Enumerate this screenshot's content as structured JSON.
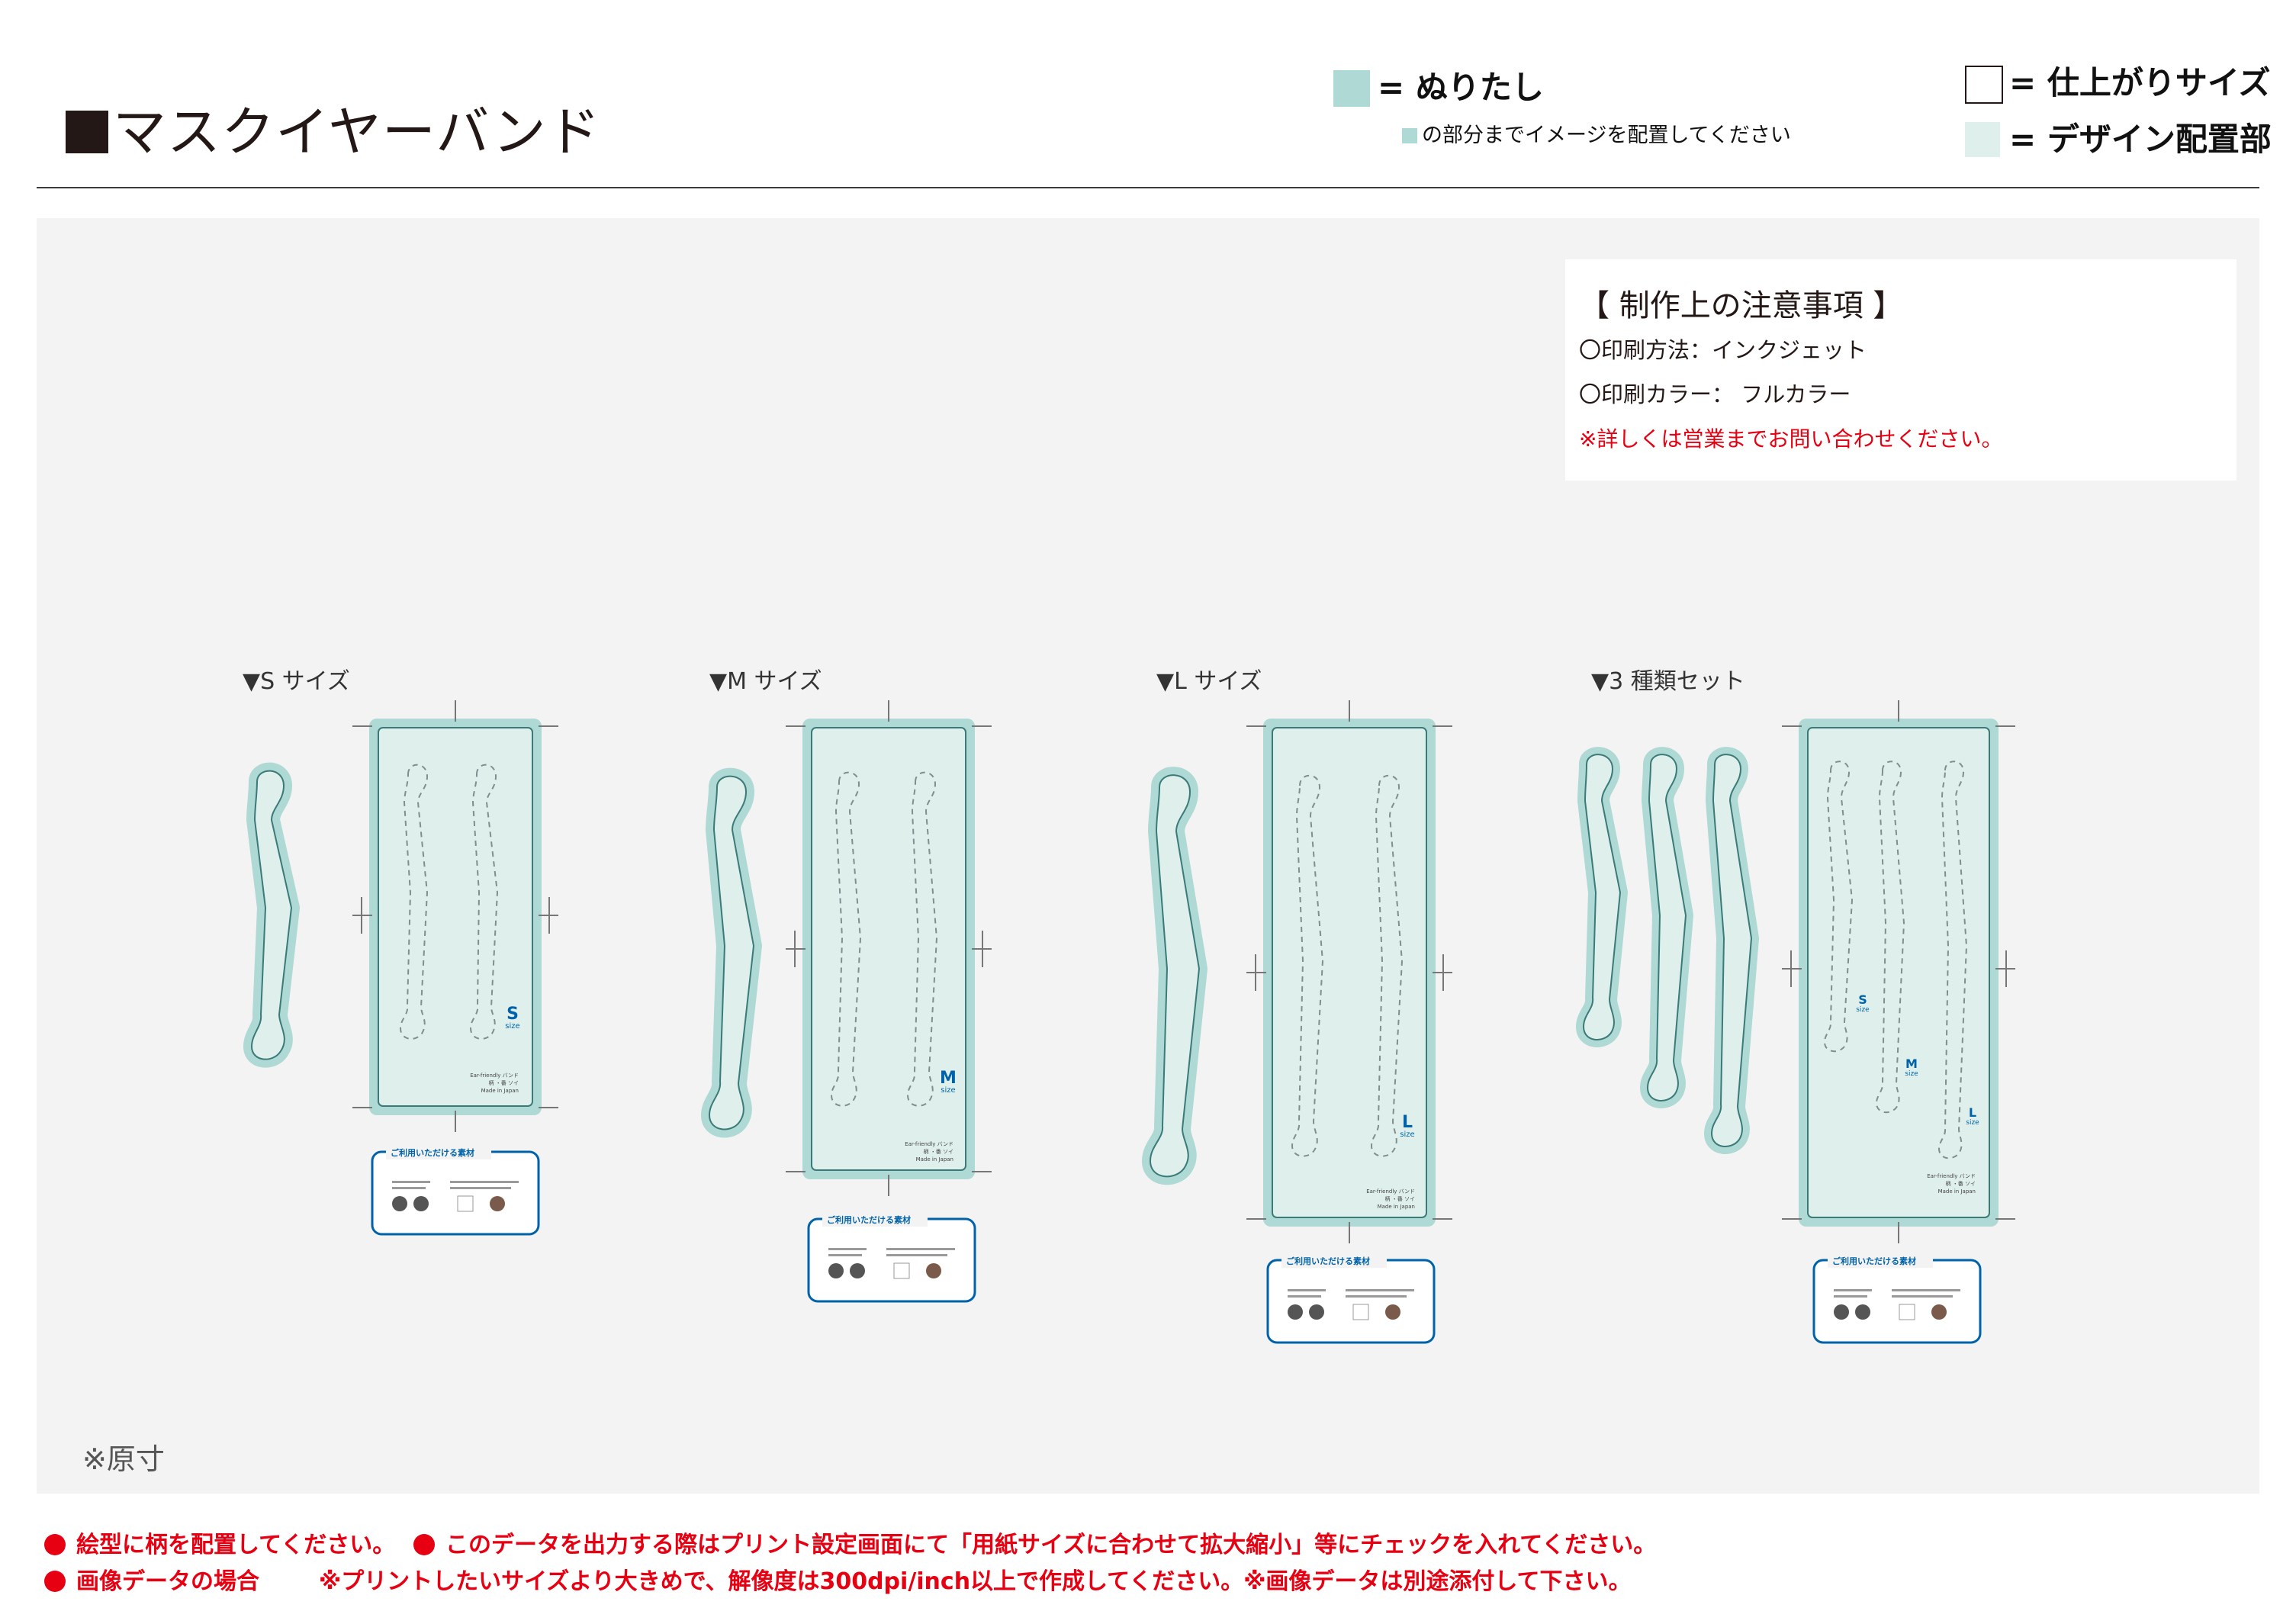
{
  "header": {
    "title": "マスクイヤーバンド",
    "legend_bleed_label": "= ぬりたし",
    "legend_bleed_note": "の部分までイメージを配置してください",
    "legend_finish_label": "= 仕上がりサイズ",
    "legend_design_label": "= デザイン配置部"
  },
  "notes": {
    "title": "【 制作上の注意事項 】",
    "print_method": "〇印刷方法：インクジェット",
    "print_color": "〇印刷カラー：  フルカラー",
    "contact": "※詳しくは営業までお問い合わせください。"
  },
  "sections": [
    {
      "label": "▼S サイズ",
      "size_letter": "S"
    },
    {
      "label": "▼M サイズ",
      "size_letter": "M"
    },
    {
      "label": "▼L サイズ",
      "size_letter": "L"
    },
    {
      "label": "▼3 種類セット",
      "size_letter": ""
    }
  ],
  "board": {
    "size_word": "size",
    "product_line1": "Ear-friendly バンド",
    "product_line2": "柄  ・番  ソイ",
    "product_line3": "Made in Japan"
  },
  "materials_title": "ご利用いただける素材",
  "scale_note": "※原寸",
  "footer": {
    "note1": "絵型に柄を配置してください。",
    "note2": "このデータを出力する際はプリント設定画面にて「用紙サイズに合わせて拡大縮小」等にチェックを入れてください。",
    "note3_label": "画像データの場合",
    "note3_text": "※プリントしたいサイズより大きめで、解像度は300dpi/inch以上で作成してください。※画像データは別途添付して下さい。"
  },
  "colors": {
    "bleed": "#aed9d4",
    "design_area": "#dff0ec",
    "accent_blue": "#0062a8",
    "warning_red": "#e60012"
  }
}
